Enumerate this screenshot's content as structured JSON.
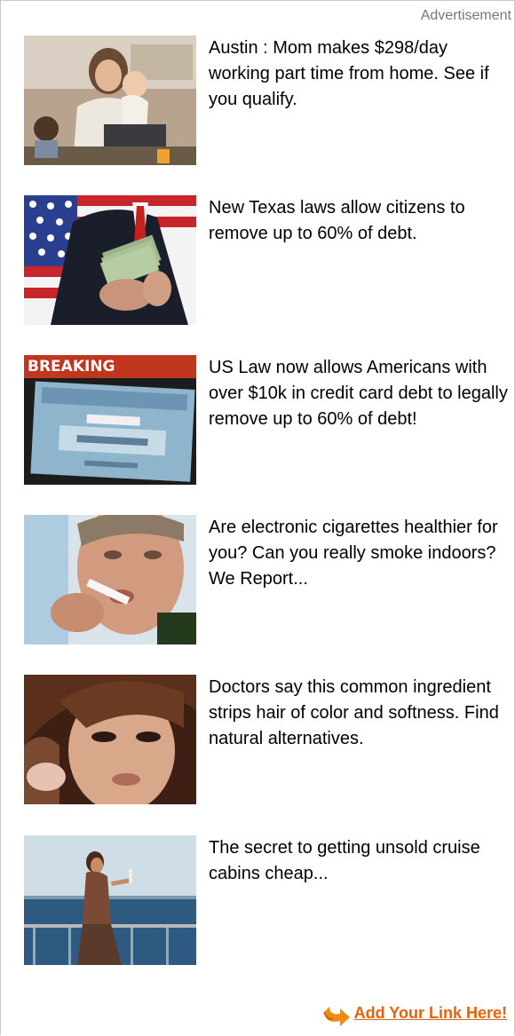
{
  "header": {
    "label": "Advertisement"
  },
  "ads": [
    {
      "text": "Austin : Mom makes $298/day working part time from home. See if you qualify.",
      "image": "mom-with-baby-laptop"
    },
    {
      "text": "New Texas laws allow citizens to remove up to 60% of debt.",
      "image": "man-holding-cash-flag"
    },
    {
      "text": "US Law now allows Americans with over $10k in credit card debt to legally remove up to 60% of debt!",
      "image": "breaking-social-security-card",
      "image_caption": "BREAKING"
    },
    {
      "text": "Are electronic cigarettes healthier for you? Can you really smoke indoors? We Report...",
      "image": "man-smoking-ecigarette"
    },
    {
      "text": "Doctors say this common ingredient strips hair of color and softness. Find natural alternatives.",
      "image": "woman-face-closeup"
    },
    {
      "text": "The secret to getting unsold cruise cabins cheap...",
      "image": "woman-on-cruise-deck"
    }
  ],
  "footer": {
    "link": "Add Your Link Here!"
  },
  "colors": {
    "link": "#e9620a",
    "adlabel": "#777777"
  }
}
